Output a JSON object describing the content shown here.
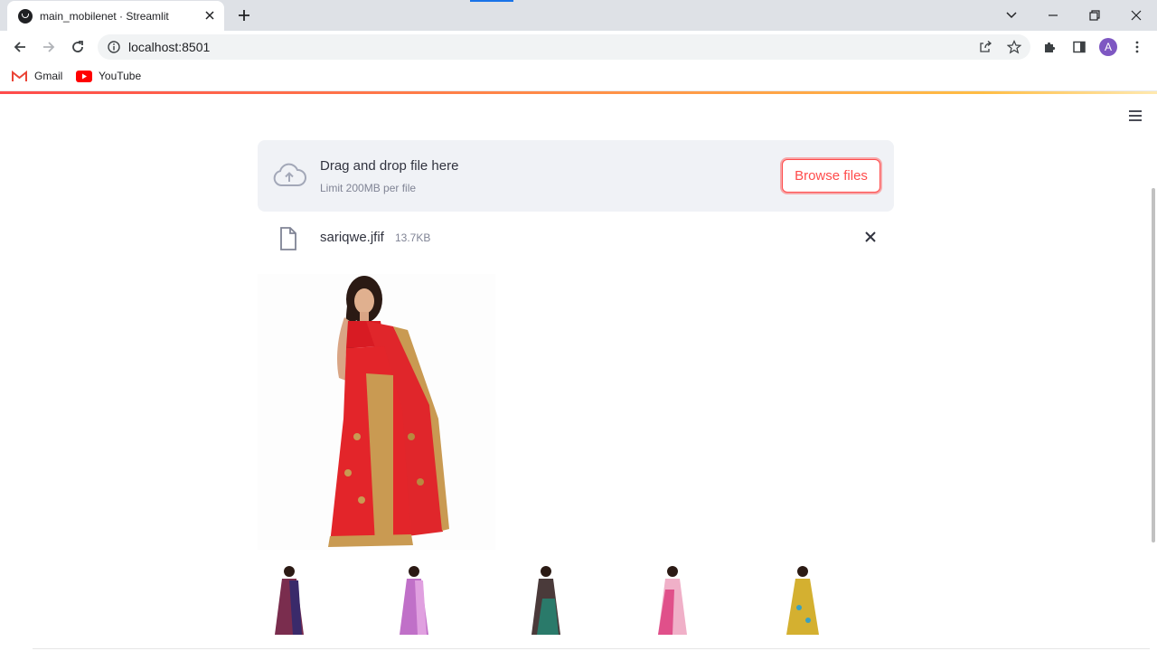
{
  "browser": {
    "tab_title": "main_mobilenet · Streamlit",
    "url": "localhost:8501",
    "avatar_letter": "A",
    "bookmarks": [
      {
        "label": "Gmail",
        "icon": "gmail-icon"
      },
      {
        "label": "YouTube",
        "icon": "youtube-icon"
      }
    ]
  },
  "uploader": {
    "drop_title": "Drag and drop file here",
    "drop_limit": "Limit 200MB per file",
    "browse_label": "Browse files",
    "file": {
      "name": "sariqwe.jfif",
      "size": "13.7KB"
    }
  },
  "results": {
    "main_image": "red-saree-image",
    "thumbnails": [
      {
        "name": "saree-thumbnail-1",
        "color": "#7a2d4e"
      },
      {
        "name": "saree-thumbnail-2",
        "color": "#c070c8"
      },
      {
        "name": "saree-thumbnail-3",
        "color": "#4a3a3a"
      },
      {
        "name": "saree-thumbnail-4",
        "color": "#e070a0"
      },
      {
        "name": "saree-thumbnail-5",
        "color": "#d4b030"
      }
    ]
  },
  "theme": {
    "accent": "#ff4b4b",
    "dropzone_bg": "#f0f2f6",
    "text": "#31333f",
    "muted": "#808495"
  }
}
